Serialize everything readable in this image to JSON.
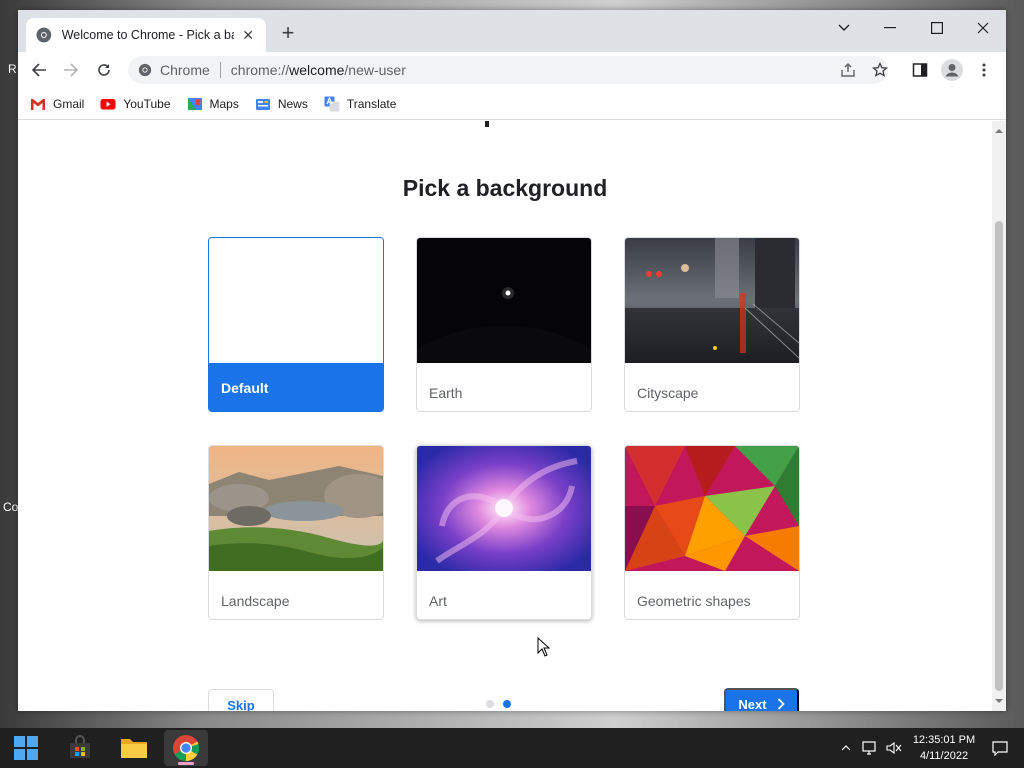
{
  "desktop": {
    "fragment_left_1": "R",
    "fragment_left_2": "Co"
  },
  "browser": {
    "tab": {
      "title": "Welcome to Chrome - Pick a bac"
    },
    "omnibox": {
      "chip": "Chrome",
      "url_prefix": "chrome://",
      "url_host": "welcome",
      "url_path": "/new-user"
    },
    "bookmarks": [
      {
        "label": "Gmail",
        "icon": "gmail-icon"
      },
      {
        "label": "YouTube",
        "icon": "youtube-icon"
      },
      {
        "label": "Maps",
        "icon": "maps-icon"
      },
      {
        "label": "News",
        "icon": "news-icon"
      },
      {
        "label": "Translate",
        "icon": "translate-icon"
      }
    ]
  },
  "page": {
    "title": "Pick a background",
    "backgrounds": [
      {
        "label": "Default",
        "selected": true
      },
      {
        "label": "Earth"
      },
      {
        "label": "Cityscape"
      },
      {
        "label": "Landscape"
      },
      {
        "label": "Art"
      },
      {
        "label": "Geometric shapes"
      }
    ],
    "skip_label": "Skip",
    "next_label": "Next",
    "step_active": 2,
    "step_total": 2
  },
  "colors": {
    "accent": "#1a73e8",
    "dot_inactive": "#dadce0"
  },
  "taskbar": {
    "time": "12:35:01 PM",
    "date": "4/11/2022"
  }
}
